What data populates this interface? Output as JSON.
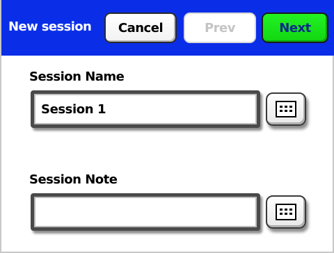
{
  "header": {
    "title": "New session",
    "cancel_label": "Cancel",
    "prev_label": "Prev",
    "next_label": "Next",
    "background_color": "#0a2ee8",
    "next_color": "#22f222"
  },
  "form": {
    "session_name": {
      "label": "Session Name",
      "value": "Session 1",
      "keyboard_icon": "keyboard-icon"
    },
    "session_note": {
      "label": "Session Note",
      "value": "",
      "keyboard_icon": "keyboard-icon"
    }
  },
  "state": {
    "prev_enabled": false
  }
}
